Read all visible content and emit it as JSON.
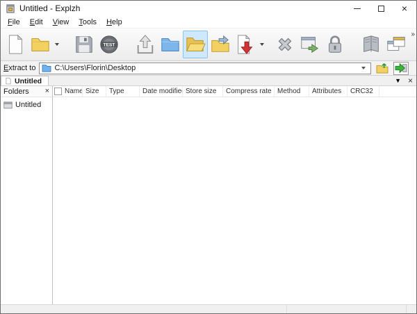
{
  "window": {
    "title": "Untitled - Explzh"
  },
  "menubar": {
    "items": [
      {
        "label": "File"
      },
      {
        "label": "Edit"
      },
      {
        "label": "View"
      },
      {
        "label": "Tools"
      },
      {
        "label": "Help"
      }
    ]
  },
  "toolbar": {
    "test_label": "TEST",
    "overflow_glyph": "»",
    "buttons": [
      {
        "name": "new-archive"
      },
      {
        "name": "open-archive",
        "has_dropdown": true
      },
      {
        "name": "save"
      },
      {
        "name": "test-archive"
      },
      {
        "name": "extract"
      },
      {
        "name": "browse-folder"
      },
      {
        "name": "open-folder",
        "selected": true
      },
      {
        "name": "compress"
      },
      {
        "name": "add-files",
        "has_dropdown": true
      },
      {
        "name": "delete"
      },
      {
        "name": "options"
      },
      {
        "name": "encrypt"
      },
      {
        "name": "manual"
      },
      {
        "name": "new-window"
      }
    ]
  },
  "extract_bar": {
    "label": "Extract to",
    "path": "C:\\Users\\Florin\\Desktop"
  },
  "tab_bar": {
    "active_tab": "Untitled",
    "menu_glyph": "▼",
    "close_glyph": "×"
  },
  "folders_panel": {
    "title": "Folders",
    "close_glyph": "×",
    "root_item": "Untitled"
  },
  "file_list": {
    "columns": [
      {
        "label": "Name"
      },
      {
        "label": "Size"
      },
      {
        "label": "Type"
      },
      {
        "label": "Date modified"
      },
      {
        "label": "Store size"
      },
      {
        "label": "Compress rate"
      },
      {
        "label": "Method"
      },
      {
        "label": "Attributes"
      },
      {
        "label": "CRC32"
      }
    ]
  }
}
